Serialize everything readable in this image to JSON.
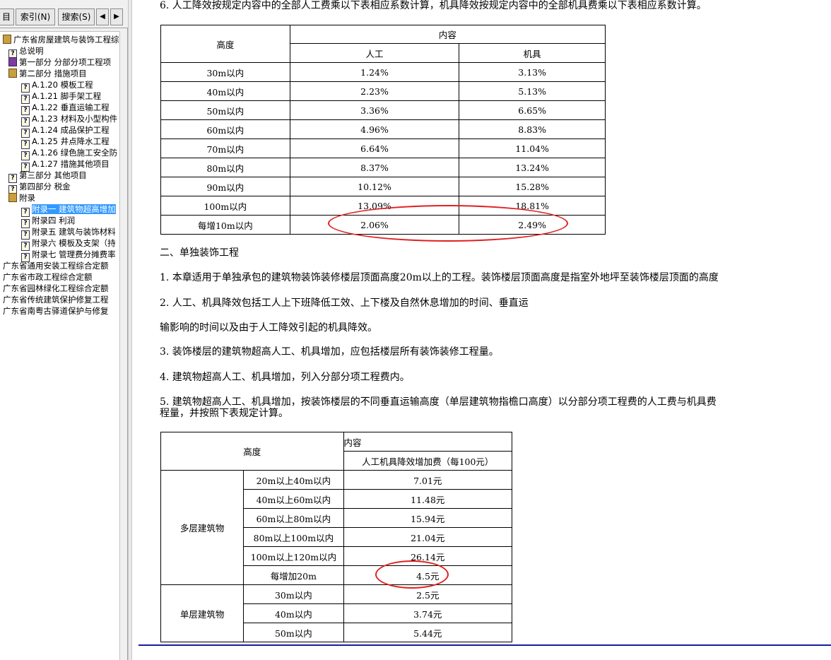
{
  "nav": {
    "tabs": {
      "contents": "目",
      "index": "索引(N)",
      "search": "搜索(S)",
      "left_arrow": "◀",
      "right_arrow": "▶"
    },
    "tree": [
      {
        "label": "广东省房屋建筑与装饰工程综",
        "icon": "book-open-icon",
        "indent": 0
      },
      {
        "label": "总说明",
        "icon": "help-page-icon",
        "indent": 1
      },
      {
        "label": "第一部分 分部分项工程项",
        "icon": "book-closed-icon",
        "indent": 1
      },
      {
        "label": "第二部分 措施项目",
        "icon": "book-open-icon",
        "indent": 1
      },
      {
        "label": "A.1.20 模板工程",
        "icon": "help-page-icon",
        "indent": 2
      },
      {
        "label": "A.1.21 脚手架工程",
        "icon": "help-page-icon",
        "indent": 2
      },
      {
        "label": "A.1.22 垂直运输工程",
        "icon": "help-page-icon",
        "indent": 2
      },
      {
        "label": "A.1.23 材料及小型构件",
        "icon": "help-page-icon",
        "indent": 2
      },
      {
        "label": "A.1.24 成品保护工程",
        "icon": "help-page-icon",
        "indent": 2
      },
      {
        "label": "A.1.25 井点降水工程",
        "icon": "help-page-icon",
        "indent": 2
      },
      {
        "label": "A.1.26 绿色施工安全防",
        "icon": "help-page-icon",
        "indent": 2
      },
      {
        "label": "A.1.27 措施其他项目",
        "icon": "help-page-icon",
        "indent": 2
      },
      {
        "label": "第三部分 其他项目",
        "icon": "help-page-icon",
        "indent": 1
      },
      {
        "label": "第四部分 税金",
        "icon": "help-page-icon",
        "indent": 1
      },
      {
        "label": "附录",
        "icon": "book-open-icon",
        "indent": 1
      },
      {
        "label": "附录一 建筑物超高增加",
        "icon": "help-page-icon",
        "indent": 2,
        "selected": true
      },
      {
        "label": "附录四 利润",
        "icon": "help-page-icon",
        "indent": 2
      },
      {
        "label": "附录五 建筑与装饰材料",
        "icon": "help-page-icon",
        "indent": 2
      },
      {
        "label": "附录六 模板及支架（持",
        "icon": "help-page-icon",
        "indent": 2
      },
      {
        "label": "附录七 管理费分摊费率",
        "icon": "help-page-icon",
        "indent": 2
      },
      {
        "label": "广东省通用安装工程综合定额",
        "icon": "none",
        "indent": 0
      },
      {
        "label": "广东省市政工程综合定额",
        "icon": "none",
        "indent": 0
      },
      {
        "label": "广东省园林绿化工程综合定额",
        "icon": "none",
        "indent": 0
      },
      {
        "label": "广东省传统建筑保护修复工程",
        "icon": "none",
        "indent": 0
      },
      {
        "label": "广东省南粤古驿道保护与修复",
        "icon": "none",
        "indent": 0
      }
    ]
  },
  "content": {
    "para_top": "6. 人工降效按规定内容中的全部人工费乘以下表相应系数计算，机具降效按规定内容中的全部机具费乘以下表相应系数计算。",
    "table1": {
      "header_height": "高度",
      "header_content": "内容",
      "header_labor": "人工",
      "header_machine": "机具",
      "rows": [
        {
          "height": "30m以内",
          "labor": "1.24%",
          "machine": "3.13%"
        },
        {
          "height": "40m以内",
          "labor": "2.23%",
          "machine": "5.13%"
        },
        {
          "height": "50m以内",
          "labor": "3.36%",
          "machine": "6.65%"
        },
        {
          "height": "60m以内",
          "labor": "4.96%",
          "machine": "8.83%"
        },
        {
          "height": "70m以内",
          "labor": "6.64%",
          "machine": "11.04%"
        },
        {
          "height": "80m以内",
          "labor": "8.37%",
          "machine": "13.24%"
        },
        {
          "height": "90m以内",
          "labor": "10.12%",
          "machine": "15.28%"
        },
        {
          "height": "100m以内",
          "labor": "13.09%",
          "machine": "18.81%"
        },
        {
          "height": "每增10m以内",
          "labor": "2.06%",
          "machine": "2.49%"
        }
      ]
    },
    "section2_title": "二、单独装饰工程",
    "para1": "1. 本章适用于单独承包的建筑物装饰装修楼层顶面高度20m以上的工程。装饰楼层顶面高度是指室外地坪至装饰楼层顶面的高度",
    "para2a": "2. 人工、机具降效包括工人上下班降低工效、上下楼及自然休息增加的时间、垂直运",
    "para2b": "输影响的时间以及由于人工降效引起的机具降效。",
    "para3": "3. 装饰楼层的建筑物超高人工、机具增加，应包括楼层所有装饰装修工程量。",
    "para4": "4. 建筑物超高人工、机具增加，列入分部分项工程费内。",
    "para5a": "5. 建筑物超高人工、机具增加，按装饰楼层的不同垂直运输高度（单层建筑物指檐口高度）以分部分项工程费的人工费与机具费",
    "para5b": "程量，并按照下表规定计算。",
    "table2": {
      "header_height": "高度",
      "header_content": "内容",
      "header_fee": "人工机具降效增加费（每100元）",
      "group_multi": "多层建筑物",
      "group_single": "单层建筑物",
      "multi_rows": [
        {
          "range": "20m以上40m以内",
          "fee": "7.01元"
        },
        {
          "range": "40m以上60m以内",
          "fee": "11.48元"
        },
        {
          "range": "60m以上80m以内",
          "fee": "15.94元"
        },
        {
          "range": "80m以上100m以内",
          "fee": "21.04元"
        },
        {
          "range": "100m以上120m以内",
          "fee": "26.14元"
        },
        {
          "range": "每增加20m",
          "fee": "4.5元"
        }
      ],
      "single_rows": [
        {
          "range": "30m以内",
          "fee": "2.5元"
        },
        {
          "range": "40m以内",
          "fee": "3.74元"
        },
        {
          "range": "50m以内",
          "fee": "5.44元"
        }
      ]
    }
  }
}
